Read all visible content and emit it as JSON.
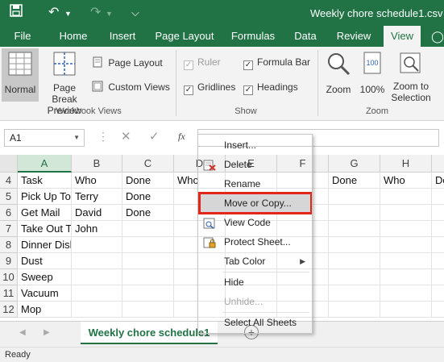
{
  "title_bar": {
    "file_title": "Weekly chore schedule1.csv",
    "accent": "#217346"
  },
  "tabs": [
    "File",
    "Home",
    "Insert",
    "Page Layout",
    "Formulas",
    "Data",
    "Review",
    "View"
  ],
  "active_tab": "View",
  "ribbon": {
    "workbook_views": {
      "label": "Workbook Views",
      "normal": "Normal",
      "page_break_1": "Page Break",
      "page_break_2": "Preview",
      "page_layout": "Page Layout",
      "custom_views": "Custom Views"
    },
    "show": {
      "label": "Show",
      "ruler": "Ruler",
      "gridlines": "Gridlines",
      "formula_bar": "Formula Bar",
      "headings": "Headings"
    },
    "zoom": {
      "label": "Zoom",
      "zoom": "Zoom",
      "hundred": "100%",
      "zoom_to_1": "Zoom to",
      "zoom_to_2": "Selection"
    }
  },
  "formula_bar": {
    "name_box": "A1",
    "fx": "fx"
  },
  "columns": [
    "A",
    "B",
    "C",
    "D",
    "E",
    "F",
    "G",
    "H",
    "I"
  ],
  "rows": [
    {
      "num": "4",
      "cells": [
        "Task",
        "Who",
        "Done",
        "Who",
        "",
        "",
        "Done",
        "Who",
        "Do"
      ]
    },
    {
      "num": "5",
      "cells": [
        "Pick Up Toys",
        "Terry",
        "Done",
        "",
        "",
        "",
        "",
        "",
        ""
      ]
    },
    {
      "num": "6",
      "cells": [
        "Get Mail",
        "David",
        "Done",
        "",
        "",
        "",
        "",
        "",
        ""
      ]
    },
    {
      "num": "7",
      "cells": [
        "Take Out Trash",
        "John",
        "",
        "",
        "",
        "",
        "",
        "",
        ""
      ]
    },
    {
      "num": "8",
      "cells": [
        "Dinner Dishes",
        "",
        "",
        "",
        "",
        "",
        "",
        "",
        ""
      ]
    },
    {
      "num": "9",
      "cells": [
        "Dust",
        "",
        "",
        "",
        "",
        "",
        "",
        "",
        ""
      ]
    },
    {
      "num": "10",
      "cells": [
        "Sweep",
        "",
        "",
        "",
        "",
        "",
        "",
        "",
        ""
      ]
    },
    {
      "num": "11",
      "cells": [
        "Vacuum",
        "",
        "",
        "",
        "",
        "",
        "",
        "",
        ""
      ]
    },
    {
      "num": "12",
      "cells": [
        "Mop",
        "",
        "",
        "",
        "",
        "",
        "",
        "",
        ""
      ]
    }
  ],
  "sheet_tab": "Weekly chore schedule1",
  "status": "Ready",
  "context_menu": {
    "items": [
      {
        "label": "Insert...",
        "icon": "",
        "disabled": false
      },
      {
        "label": "Delete",
        "icon": "delete-sheet-icon",
        "disabled": false
      },
      {
        "label": "Rename",
        "icon": "",
        "disabled": false
      },
      {
        "label": "Move or Copy...",
        "icon": "",
        "disabled": false,
        "highlighted": true
      },
      {
        "label": "View Code",
        "icon": "view-code-icon",
        "disabled": false
      },
      {
        "label": "Protect Sheet...",
        "icon": "protect-sheet-icon",
        "disabled": false
      },
      {
        "label": "Tab Color",
        "icon": "",
        "disabled": false,
        "submenu": true
      },
      {
        "label": "Hide",
        "icon": "",
        "disabled": false
      },
      {
        "label": "Unhide...",
        "icon": "",
        "disabled": true
      },
      {
        "label": "Select All Sheets",
        "icon": "",
        "disabled": false
      }
    ]
  }
}
